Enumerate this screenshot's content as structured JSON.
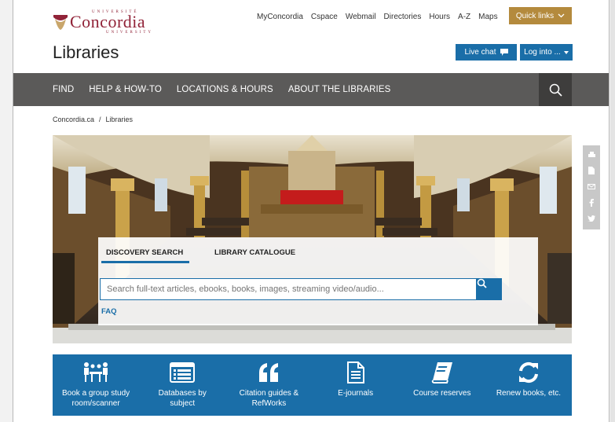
{
  "logo": {
    "university_top": "UNIVERSITÉ",
    "name": "Concordia",
    "university_bottom": "UNIVERSITY"
  },
  "topnav": [
    "MyConcordia",
    "Cspace",
    "Webmail",
    "Directories",
    "Hours",
    "A-Z",
    "Maps"
  ],
  "quick_links_label": "Quick links",
  "page_title": "Libraries",
  "live_chat_label": "Live chat",
  "login_label": "Log into ...",
  "mainnav": [
    "FIND",
    "HELP & HOW-TO",
    "LOCATIONS & HOURS",
    "ABOUT THE LIBRARIES"
  ],
  "breadcrumb": {
    "home": "Concordia.ca",
    "separator": "/",
    "current": "Libraries"
  },
  "search": {
    "tab_discovery": "DISCOVERY SEARCH",
    "tab_catalogue": "LIBRARY CATALOGUE",
    "placeholder": "Search full-text articles, ebooks, books, images, streaming video/audio...",
    "faq": "FAQ"
  },
  "share_icons": [
    "print-icon",
    "pdf-icon",
    "email-icon",
    "facebook-icon",
    "twitter-icon"
  ],
  "quick_links": [
    {
      "label_line1": "Book a group study",
      "label_line2": "room/scanner",
      "icon": "group-study-icon"
    },
    {
      "label_line1": "Databases by",
      "label_line2": "subject",
      "icon": "database-list-icon"
    },
    {
      "label_line1": "Citation guides &",
      "label_line2": "RefWorks",
      "icon": "quote-icon"
    },
    {
      "label_line1": "E-journals",
      "label_line2": "",
      "icon": "document-icon"
    },
    {
      "label_line1": "Course reserves",
      "label_line2": "",
      "icon": "book-icon"
    },
    {
      "label_line1": "Renew books, etc.",
      "label_line2": "",
      "icon": "refresh-icon"
    }
  ],
  "colors": {
    "brand": "#912338",
    "blue": "#1a6ea8",
    "gold": "#b48a3d",
    "nav": "#5b5a59"
  }
}
